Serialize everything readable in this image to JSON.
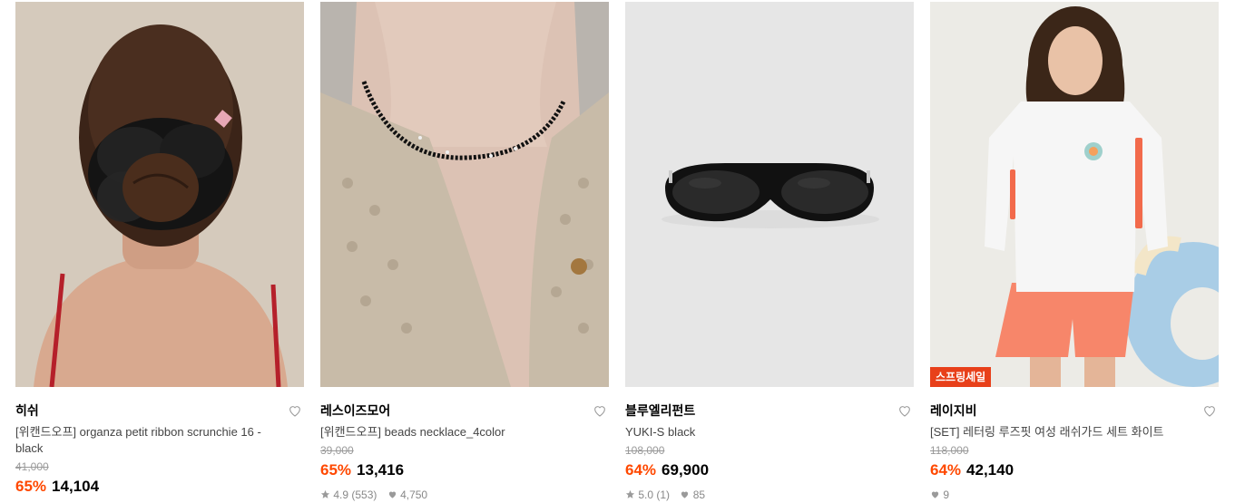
{
  "products": [
    {
      "brand": "히쉬",
      "name": "[위캔드오프] organza petit ribbon scrunchie 16 - black",
      "original_price": "41,000",
      "discount": "65%",
      "price": "14,104",
      "rating": "",
      "reviews": "",
      "likes": "",
      "badge": "",
      "image": "black organza scrunchie in hair, back view"
    },
    {
      "brand": "레스이즈모어",
      "name": "[위캔드오프] beads necklace_4color",
      "original_price": "39,000",
      "discount": "65%",
      "price": "13,416",
      "rating": "4.9",
      "reviews": "(553)",
      "likes": "4,750",
      "badge": "",
      "image": "black bead necklace on neck"
    },
    {
      "brand": "블루엘리펀트",
      "name": "YUKI-S black",
      "original_price": "108,000",
      "discount": "64%",
      "price": "69,900",
      "rating": "5.0",
      "reviews": "(1)",
      "likes": "85",
      "badge": "",
      "image": "black oval sunglasses"
    },
    {
      "brand": "레이지비",
      "name": "[SET] 레터링 루즈핏 여성 래쉬가드 세트 화이트",
      "original_price": "118,000",
      "discount": "64%",
      "price": "42,140",
      "rating": "",
      "reviews": "",
      "likes": "9",
      "badge": "스프링세일",
      "image": "woman in white rash guard and coral shorts"
    }
  ],
  "colors": {
    "discount": "#ff4800",
    "badge": "#e8401a"
  },
  "icons": {
    "like": "heart-icon",
    "star": "star-icon"
  }
}
